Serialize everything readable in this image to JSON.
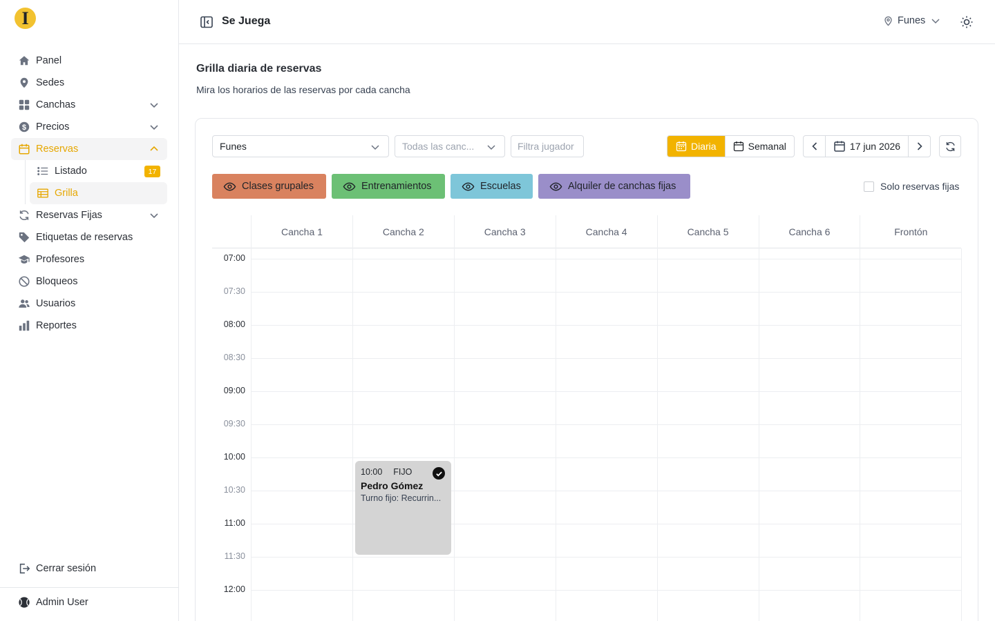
{
  "app": {
    "title": "Se Juega",
    "location": "Funes",
    "logo_letter": "I"
  },
  "sidebar": {
    "items": [
      {
        "label": "Panel",
        "icon": "home-icon"
      },
      {
        "label": "Sedes",
        "icon": "map-pin-icon"
      },
      {
        "label": "Canchas",
        "icon": "grid-icon",
        "expandable": true
      },
      {
        "label": "Precios",
        "icon": "dollar-icon",
        "expandable": true
      },
      {
        "label": "Reservas",
        "icon": "calendar-icon",
        "expandable": true,
        "active": true,
        "children": [
          {
            "label": "Listado",
            "icon": "list-icon",
            "badge": "17"
          },
          {
            "label": "Grilla",
            "icon": "table-icon",
            "selected": true
          }
        ]
      },
      {
        "label": "Reservas Fijas",
        "icon": "repeat-icon",
        "expandable": true
      },
      {
        "label": "Etiquetas de reservas",
        "icon": "tag-icon"
      },
      {
        "label": "Profesores",
        "icon": "graduation-cap-icon"
      },
      {
        "label": "Bloqueos",
        "icon": "ban-icon"
      },
      {
        "label": "Usuarios",
        "icon": "users-icon"
      },
      {
        "label": "Reportes",
        "icon": "bar-chart-icon"
      }
    ],
    "logout": "Cerrar sesión",
    "user": "Admin User"
  },
  "page": {
    "title": "Grilla diaria de reservas",
    "subtitle": "Mira los horarios de las reservas por cada cancha"
  },
  "toolbar": {
    "sede_value": "Funes",
    "canchas_placeholder": "Todas las canc...",
    "jugador_placeholder": "Filtra jugador",
    "view_daily": "Diaria",
    "view_weekly": "Semanal",
    "date": "17 jun 2026"
  },
  "filters": [
    {
      "label": "Clases grupales",
      "color": "#d9825f"
    },
    {
      "label": "Entrenamientos",
      "color": "#6cc075"
    },
    {
      "label": "Escuelas",
      "color": "#7ec6d9"
    },
    {
      "label": "Alquiler de canchas fijas",
      "color": "#9a8ec9"
    }
  ],
  "solo_fijas_label": "Solo reservas fijas",
  "grid": {
    "courts": [
      "Cancha 1",
      "Cancha 2",
      "Cancha 3",
      "Cancha 4",
      "Cancha 5",
      "Cancha 6",
      "Frontón"
    ],
    "times": [
      "07:00",
      "07:30",
      "08:00",
      "08:30",
      "09:00",
      "09:30",
      "10:00",
      "10:30",
      "11:00",
      "11:30",
      "12:00"
    ]
  },
  "reservation": {
    "time": "10:00",
    "tag": "FIJO",
    "player": "Pedro Gómez",
    "description": "Turno fijo: Recurrin...",
    "court": "Cancha 2",
    "color": "#d4d4d4"
  },
  "colors": {
    "accent": "#f2b300"
  }
}
